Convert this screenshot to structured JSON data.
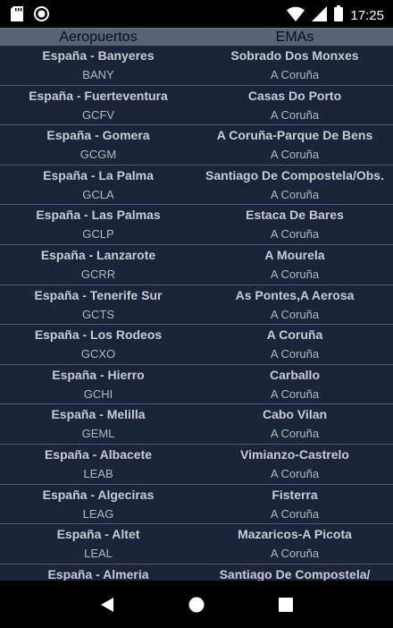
{
  "status_bar": {
    "time": "17:25",
    "icons": [
      "sd-card-icon",
      "record-icon",
      "wifi-icon",
      "signal-icon",
      "battery-icon"
    ]
  },
  "table": {
    "headers": [
      "Aeropuertos",
      "EMAs"
    ],
    "rows": [
      {
        "airport": "España - Banyeres",
        "code": "BANY",
        "ema": "Sobrado Dos Monxes",
        "region": "A Coruña"
      },
      {
        "airport": "España - Fuerteventura",
        "code": "GCFV",
        "ema": "Casas Do Porto",
        "region": "A Coruña"
      },
      {
        "airport": "España - Gomera",
        "code": "GCGM",
        "ema": "A Coruña-Parque De Bens",
        "region": "A Coruña"
      },
      {
        "airport": "España - La Palma",
        "code": "GCLA",
        "ema": "Santiago De Compostela/Obs.",
        "region": "A Coruña"
      },
      {
        "airport": "España - Las Palmas",
        "code": "GCLP",
        "ema": "Estaca De Bares",
        "region": "A Coruña"
      },
      {
        "airport": "España - Lanzarote",
        "code": "GCRR",
        "ema": "A Mourela",
        "region": "A Coruña"
      },
      {
        "airport": "España - Tenerife Sur",
        "code": "GCTS",
        "ema": "As Pontes,A Aerosa",
        "region": "A Coruña"
      },
      {
        "airport": "España - Los Rodeos",
        "code": "GCXO",
        "ema": "A Coruña",
        "region": "A Coruña"
      },
      {
        "airport": "España - Hierro",
        "code": "GCHI",
        "ema": "Carballo",
        "region": "A Coruña"
      },
      {
        "airport": "España - Melilla",
        "code": "GEML",
        "ema": "Cabo Vilan",
        "region": "A Coruña"
      },
      {
        "airport": "España - Albacete",
        "code": "LEAB",
        "ema": "Vimianzo-Castrelo",
        "region": "A Coruña"
      },
      {
        "airport": "España - Algeciras",
        "code": "LEAG",
        "ema": "Fisterra",
        "region": "A Coruña"
      },
      {
        "airport": "España - Altet",
        "code": "LEAL",
        "ema": "Mazaricos-A Picota",
        "region": "A Coruña"
      },
      {
        "airport": "España - Almeria",
        "code": "",
        "ema": "Santiago De Compostela/",
        "region": ""
      }
    ]
  },
  "nav_bar": {
    "buttons": [
      "back",
      "home",
      "recents"
    ]
  }
}
